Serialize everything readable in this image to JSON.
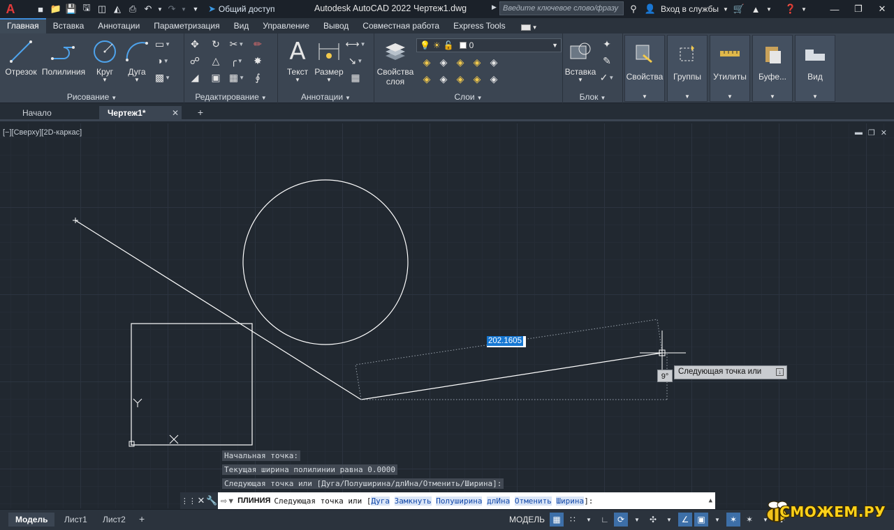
{
  "titlebar": {
    "logo": "A",
    "share_label": "Общий доступ",
    "app_title": "Autodesk AutoCAD 2022",
    "file_name": "Чертеж1.dwg",
    "search_placeholder": "Введите ключевое слово/фразу",
    "signin_label": "Вход в службы"
  },
  "ribbon_tabs": [
    "Главная",
    "Вставка",
    "Аннотации",
    "Параметризация",
    "Вид",
    "Управление",
    "Вывод",
    "Совместная работа",
    "Express Tools"
  ],
  "panels": {
    "draw": {
      "title": "Рисование",
      "line": "Отрезок",
      "polyline": "Полилиния",
      "circle": "Круг",
      "arc": "Дуга"
    },
    "modify": {
      "title": "Редактирование"
    },
    "annotation": {
      "title": "Аннотации",
      "text": "Текст",
      "dimension": "Размер"
    },
    "layers": {
      "title": "Слои",
      "properties_line1": "Свойства",
      "properties_line2": "слоя",
      "current_layer": "0"
    },
    "block": {
      "title": "Блок",
      "insert": "Вставка"
    },
    "properties": {
      "label": "Свойства"
    },
    "groups": {
      "label": "Группы"
    },
    "utilities": {
      "label": "Утилиты"
    },
    "clipboard": {
      "label": "Буфе..."
    },
    "view": {
      "label": "Вид"
    }
  },
  "file_tabs": {
    "start": "Начало",
    "drawing": "Чертеж1*"
  },
  "viewport": {
    "label": "[−][Сверху][2D-каркас]",
    "dynamic_length": "202.1605",
    "angle": "9°",
    "prompt_tip": "Следующая точка или"
  },
  "history": [
    "Начальная точка:",
    "Текущая ширина полилинии равна 0.0000",
    "Следующая точка или [Дуга/Полуширина/длИна/Отменить/Ширина]:"
  ],
  "command": {
    "name": "ПЛИНИЯ",
    "text": "Следующая точка или [",
    "options": [
      "Дуга",
      "Замкнуть",
      "Полуширина",
      "длИна",
      "Отменить",
      "Ширина"
    ],
    "suffix": "]:"
  },
  "status": {
    "layouts": [
      "Модель",
      "Лист1",
      "Лист2"
    ],
    "model_label": "МОДЕЛЬ"
  },
  "watermark": "СМОЖЕМ.РУ",
  "colors": {
    "background": "#212830",
    "ribbon": "#3b4552",
    "accent": "#1677d2",
    "geometry": "#ffffff"
  }
}
